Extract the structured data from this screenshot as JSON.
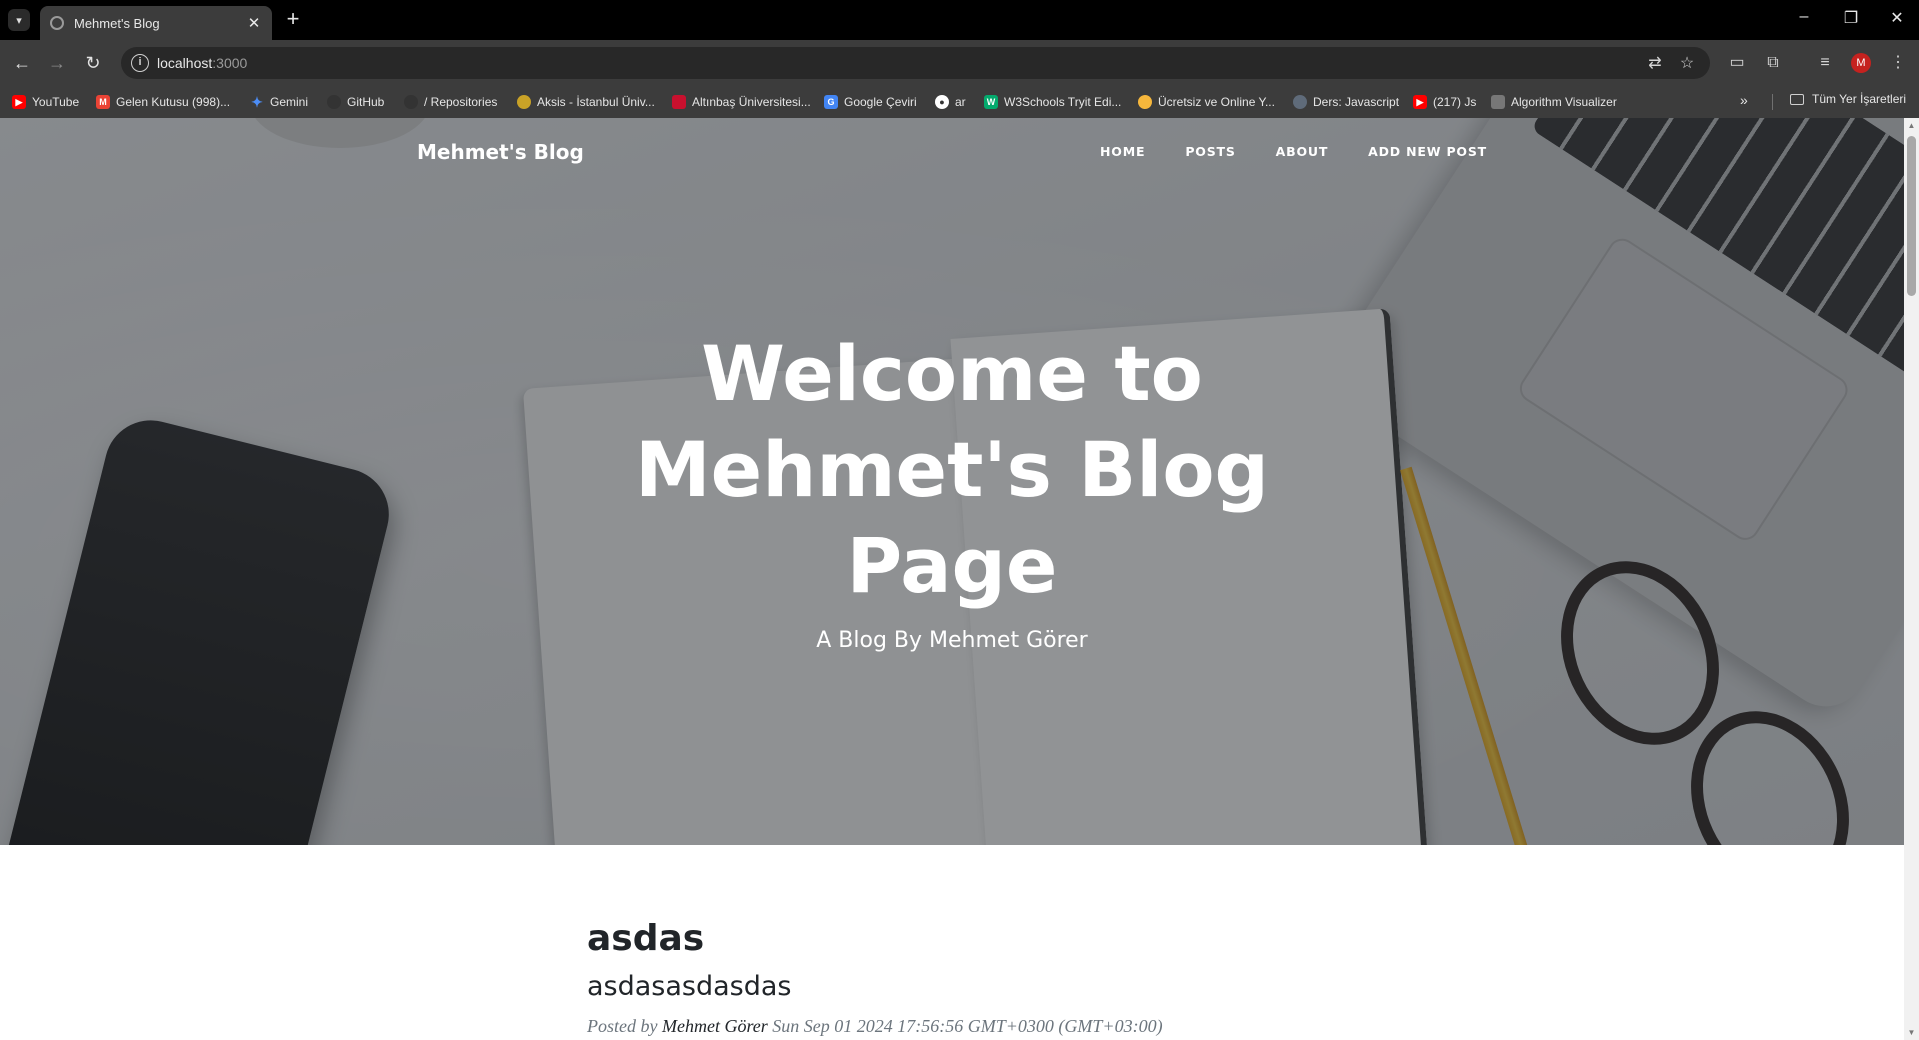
{
  "browser": {
    "tab_title": "Mehmet's Blog",
    "url_host": "localhost",
    "url_port": ":3000",
    "profile_initial": "M",
    "bookmarks": [
      {
        "label": "YouTube",
        "color": "#ff0000"
      },
      {
        "label": "Gelen Kutusu (998)...",
        "color": "#ea4335"
      },
      {
        "label": "Gemini",
        "color": "#4c8df6"
      },
      {
        "label": "GitHub",
        "color": "#333333"
      },
      {
        "label": "/ Repositories",
        "color": "#333333"
      },
      {
        "label": "Aksis - İstanbul Üniv...",
        "color": "#c9a227"
      },
      {
        "label": "Altınbaş Üniversitesi...",
        "color": "#c8102e"
      },
      {
        "label": "Google Çeviri",
        "color": "#4285f4"
      },
      {
        "label": "ar",
        "color": "#ffffff"
      },
      {
        "label": "W3Schools Tryit Edi...",
        "color": "#04aa6d"
      },
      {
        "label": "Ücretsiz ve Online Y...",
        "color": "#f6b73c"
      },
      {
        "label": "Ders: Javascript",
        "color": "#5f6b7a"
      },
      {
        "label": "(217) Js",
        "color": "#ff0000"
      },
      {
        "label": "Algorithm Visualizer",
        "color": "#777777"
      }
    ],
    "all_bookmarks_label": "Tüm Yer İşaretleri"
  },
  "site": {
    "brand": "Mehmet's Blog",
    "nav": [
      "HOME",
      "POSTS",
      "ABOUT",
      "ADD NEW POST"
    ],
    "hero_title": "Welcome to Mehmet's Blog Page",
    "hero_subtitle": "A Blog By Mehmet Görer"
  },
  "post": {
    "title": "asdas",
    "subtitle": "asdasasdasdas",
    "posted_by_label": "Posted by",
    "author": "Mehmet Görer",
    "date": "Sun Sep 01 2024 17:56:56 GMT+0300 (GMT+03:00)"
  }
}
